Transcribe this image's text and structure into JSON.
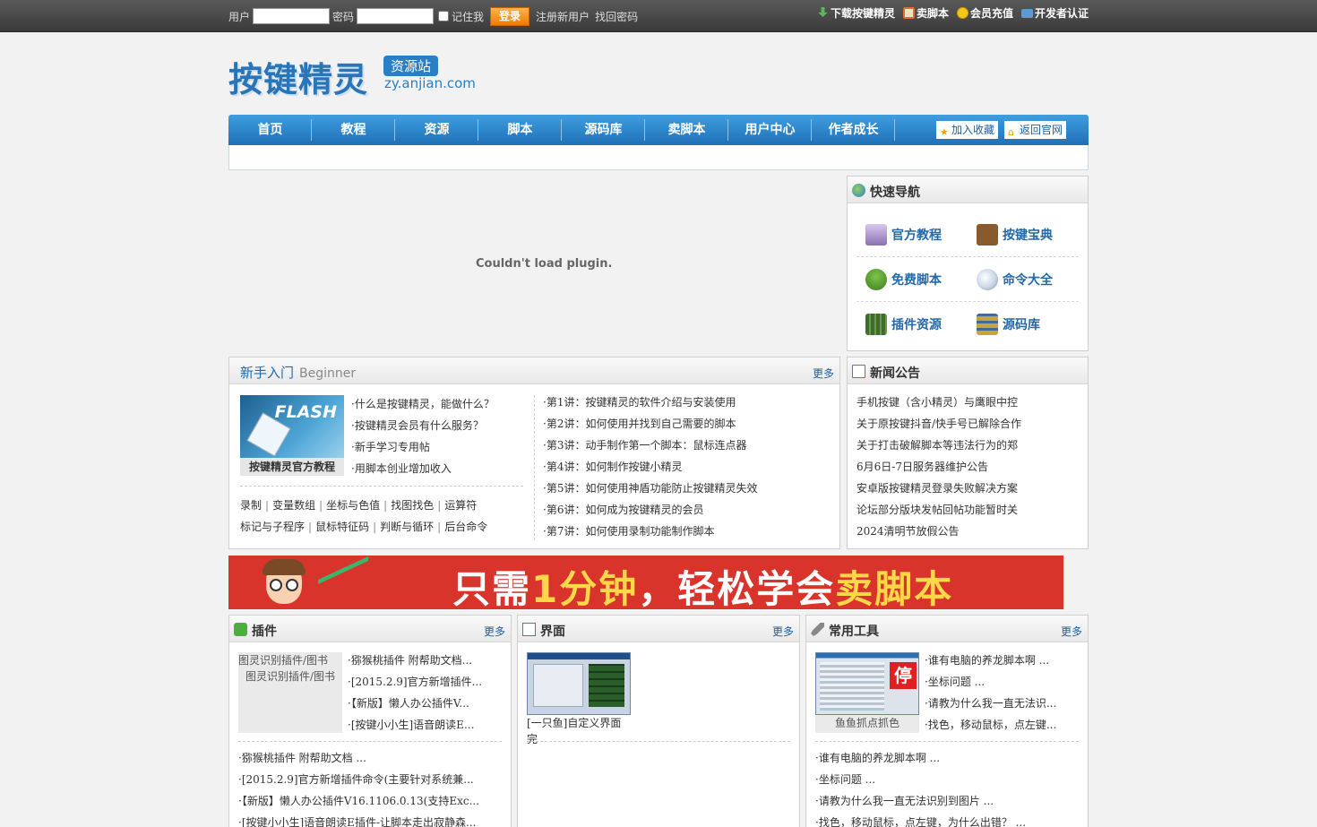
{
  "topbar": {
    "user_label": "用户",
    "pass_label": "密码",
    "remember_label": "记住我",
    "login_button": "登录",
    "register_link": "注册新用户",
    "recover_link": "找回密码",
    "links": [
      {
        "label": "下载按键精灵",
        "icon": "download-icon"
      },
      {
        "label": "卖脚本",
        "icon": "cart-icon"
      },
      {
        "label": "会员充值",
        "icon": "coin-icon"
      },
      {
        "label": "开发者认证",
        "icon": "card-icon"
      }
    ]
  },
  "logo": {
    "main": "按键精灵",
    "tag": "资源站",
    "url": "zy.anjian.com"
  },
  "nav": {
    "items": [
      "首页",
      "教程",
      "资源",
      "脚本",
      "源码库",
      "卖脚本",
      "用户中心",
      "作者成长"
    ],
    "add_favorite": "加入收藏",
    "back_official": "返回官网"
  },
  "plugin": {
    "message": "Couldn't load plugin."
  },
  "quick_nav": {
    "title": "快速导航",
    "items": [
      {
        "label": "官方教程",
        "icon": "monitor-icon",
        "color": "#8a6fb0"
      },
      {
        "label": "按键宝典",
        "icon": "book-icon",
        "color": "#8b5a2b"
      },
      {
        "label": "免费脚本",
        "icon": "tree-icon",
        "color": "#4c9a2a"
      },
      {
        "label": "命令大全",
        "icon": "magnifier-icon",
        "color": "#c9d6e6"
      },
      {
        "label": "插件资源",
        "icon": "chip-icon",
        "color": "#3f6b2f"
      },
      {
        "label": "源码库",
        "icon": "grid-icon",
        "color": "#c9a23a"
      }
    ]
  },
  "beginner": {
    "title": "新手入门",
    "title_en": "Beginner",
    "more": "更多",
    "thumb_text": "FLASH",
    "thumb_caption": "按键精灵官方教程",
    "questions": [
      "·什么是按键精灵，能做什么？",
      "·按键精灵会员有什么服务？",
      "·新手学习专用帖",
      "·用脚本创业增加收入"
    ],
    "tags_row1": [
      "录制",
      "变量数组",
      "坐标与色值",
      "找图找色",
      "运算符"
    ],
    "tags_row2": [
      "标记与子程序",
      "鼠标特征码",
      "判断与循环",
      "后台命令"
    ],
    "lessons": [
      "·第1讲：按键精灵的软件介绍与安装使用",
      "·第2讲：如何使用并找到自己需要的脚本",
      "·第3讲：动手制作第一个脚本：鼠标连点器",
      "·第4讲：如何制作按键小精灵",
      "·第5讲：如何使用神盾功能防止按键精灵失效",
      "·第6讲：如何成为按键精灵的会员",
      "·第7讲：如何使用录制功能制作脚本"
    ]
  },
  "news": {
    "title": "新闻公告",
    "items": [
      "手机按键（含小精灵）与鹰眼中控",
      "关于原按键抖音/快手号已解除合作",
      "关于打击破解脚本等违法行为的郑",
      "6月6日-7日服务器维护公告",
      "安卓版按键精灵登录失败解决方案",
      "论坛部分版块发帖回帖功能暂时关",
      "2024清明节放假公告"
    ]
  },
  "banner": {
    "text_a": "只需",
    "text_b": "1分钟",
    "text_c": "，轻松学会",
    "text_d": "卖脚本"
  },
  "boxes": [
    {
      "title": "插件",
      "more": "更多",
      "icon": "puzzle-icon",
      "pic_caption": "图灵识别插件/图书",
      "pic_alt": "图灵识别插件/图书",
      "short": [
        "·猕猴桃插件 附帮助文档...",
        "·[2015.2.9]官方新增插件...",
        "·【新版】懒人办公插件V...",
        "·[按键小小生]语音朗读E..."
      ],
      "long": [
        "·猕猴桃插件 附帮助文档 ...",
        "·[2015.2.9]官方新增插件命令(主要针对系统兼...",
        "·【新版】懒人办公插件V16.1106.0.13(支持Exc...",
        "·[按键小小生]语音朗读E插件-让脚本走出寂静森..."
      ]
    },
    {
      "title": "界面",
      "more": "更多",
      "icon": "window-icon",
      "pic_caption": "[一只鱼]自定义界面完",
      "short": [],
      "long": []
    },
    {
      "title": "常用工具",
      "more": "更多",
      "icon": "wrench-icon",
      "pic_caption": "鱼鱼抓点抓色",
      "pic_badge": "停",
      "short": [
        "·谁有电脑的养龙脚本啊 ...",
        "·坐标问题 ...",
        "·请教为什么我一直无法识...",
        "·找色，移动鼠标，点左键..."
      ],
      "long": [
        "·谁有电脑的养龙脚本啊 ...",
        "·坐标问题 ...",
        "·请教为什么我一直无法识别到图片 ...",
        "·找色，移动鼠标，点左键，为什么出错？ ..."
      ]
    }
  ]
}
